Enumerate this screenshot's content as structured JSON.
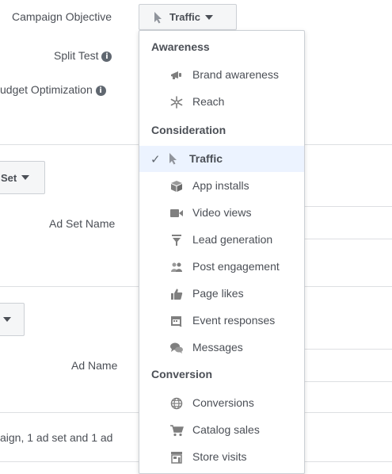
{
  "campaign": {
    "objective_label": "Campaign Objective",
    "objective_value": "Traffic",
    "split_test_label": "Split Test",
    "budget_opt_label": "udget Optimization",
    "info_glyph": "i"
  },
  "adset": {
    "button_label": "Set",
    "name_label": "Ad Set Name"
  },
  "ad": {
    "name_label": "Ad Name"
  },
  "footer_text": "aign, 1 ad set and 1 ad",
  "menu": {
    "check_glyph": "✓",
    "sections": {
      "awareness": "Awareness",
      "consideration": "Consideration",
      "conversion": "Conversion"
    },
    "items": {
      "brand_awareness": "Brand awareness",
      "reach": "Reach",
      "traffic": "Traffic",
      "app_installs": "App installs",
      "video_views": "Video views",
      "lead_generation": "Lead generation",
      "post_engagement": "Post engagement",
      "page_likes": "Page likes",
      "event_responses": "Event responses",
      "messages": "Messages",
      "conversions": "Conversions",
      "catalog_sales": "Catalog sales",
      "store_visits": "Store visits"
    },
    "selected": "traffic",
    "colors": {
      "selected_bg": "#ecf3ff",
      "icon": "#7f7f7f"
    }
  }
}
